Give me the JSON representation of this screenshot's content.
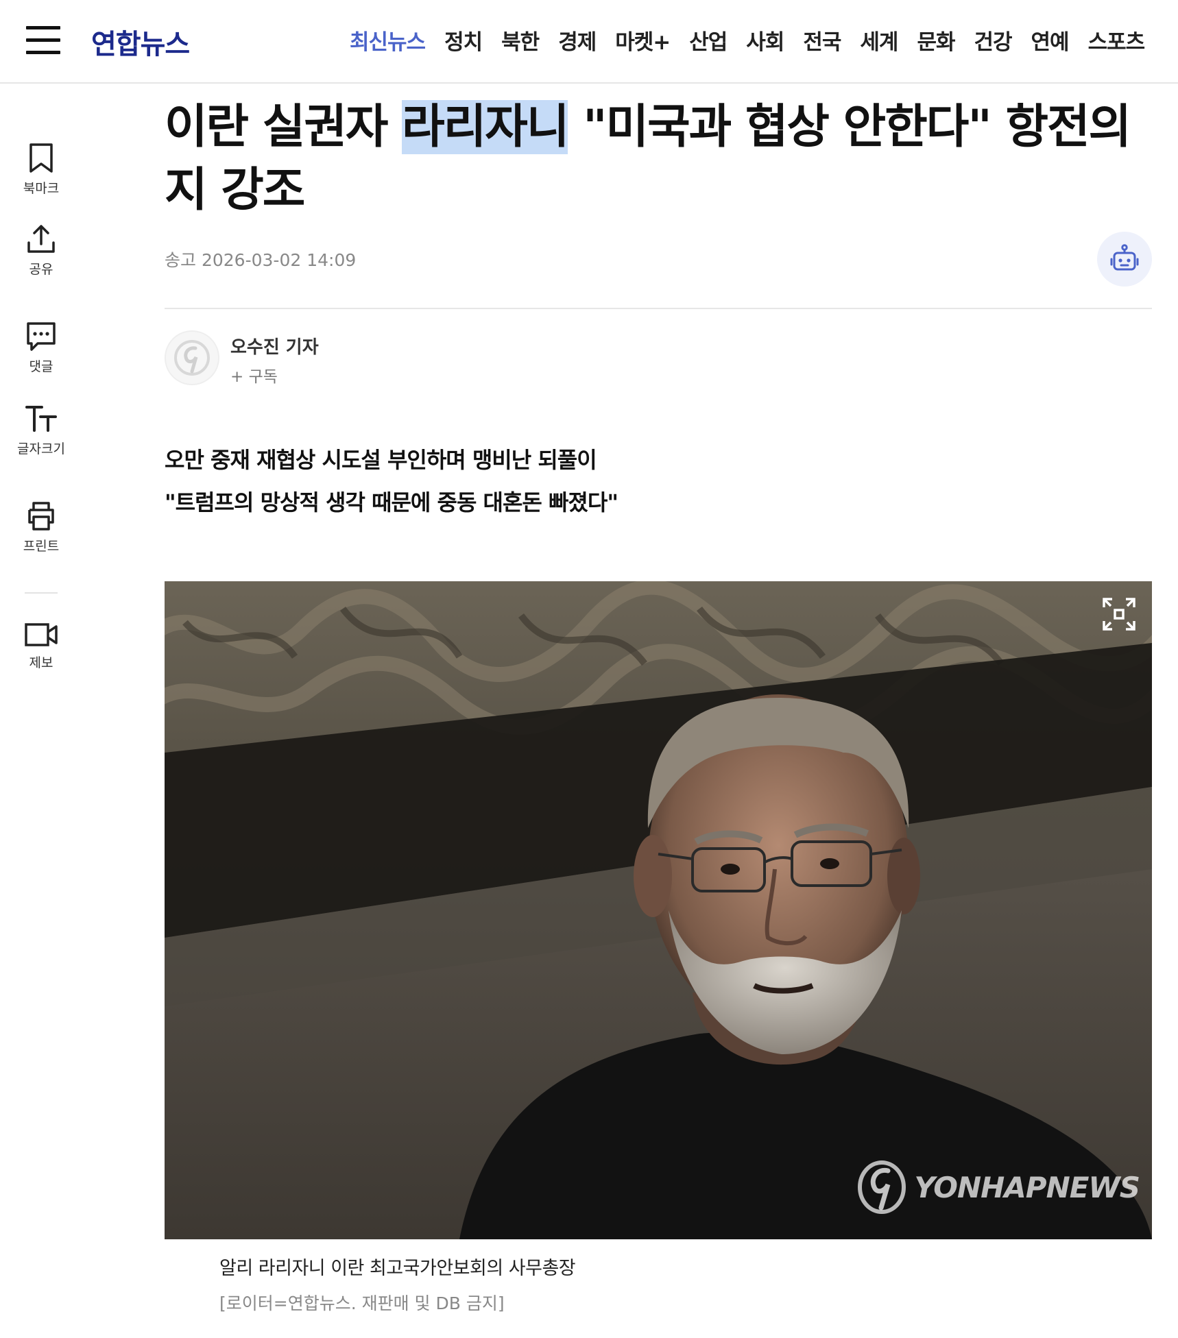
{
  "header": {
    "logo": "연합뉴스",
    "nav": [
      "최신뉴스",
      "정치",
      "북한",
      "경제",
      "마켓+",
      "산업",
      "사회",
      "전국",
      "세계",
      "문화",
      "건강",
      "연예",
      "스포츠"
    ],
    "active_nav": "최신뉴스"
  },
  "rail": {
    "bookmark": "북마크",
    "share": "공유",
    "comment": "댓글",
    "fontsize": "글자크기",
    "print": "프린트",
    "report": "제보"
  },
  "article": {
    "title_before": "이란 실권자 ",
    "title_highlight": "라리자니",
    "title_after": " \"미국과 협상 안한다\" 항전의지 강조",
    "meta_label": "송고",
    "published": "2026-03-02 14:09",
    "reporter": "오수진 기자",
    "subscribe": "+ 구독",
    "summary": [
      "오만 중재 재협상 시도설 부인하며 맹비난 되풀이",
      "\"트럼프의 망상적 생각 때문에 중동 대혼돈 빠졌다\""
    ],
    "photo": {
      "watermark": "YONHAPNEWS",
      "caption": "알리 라리자니 이란 최고국가안보회의 사무총장",
      "credit": "[로이터=연합뉴스. 재판매 및 DB 금지]"
    }
  },
  "colors": {
    "brand": "#1c2a8c",
    "active_nav": "#4a63c9",
    "highlight": "#c5dbf7"
  }
}
